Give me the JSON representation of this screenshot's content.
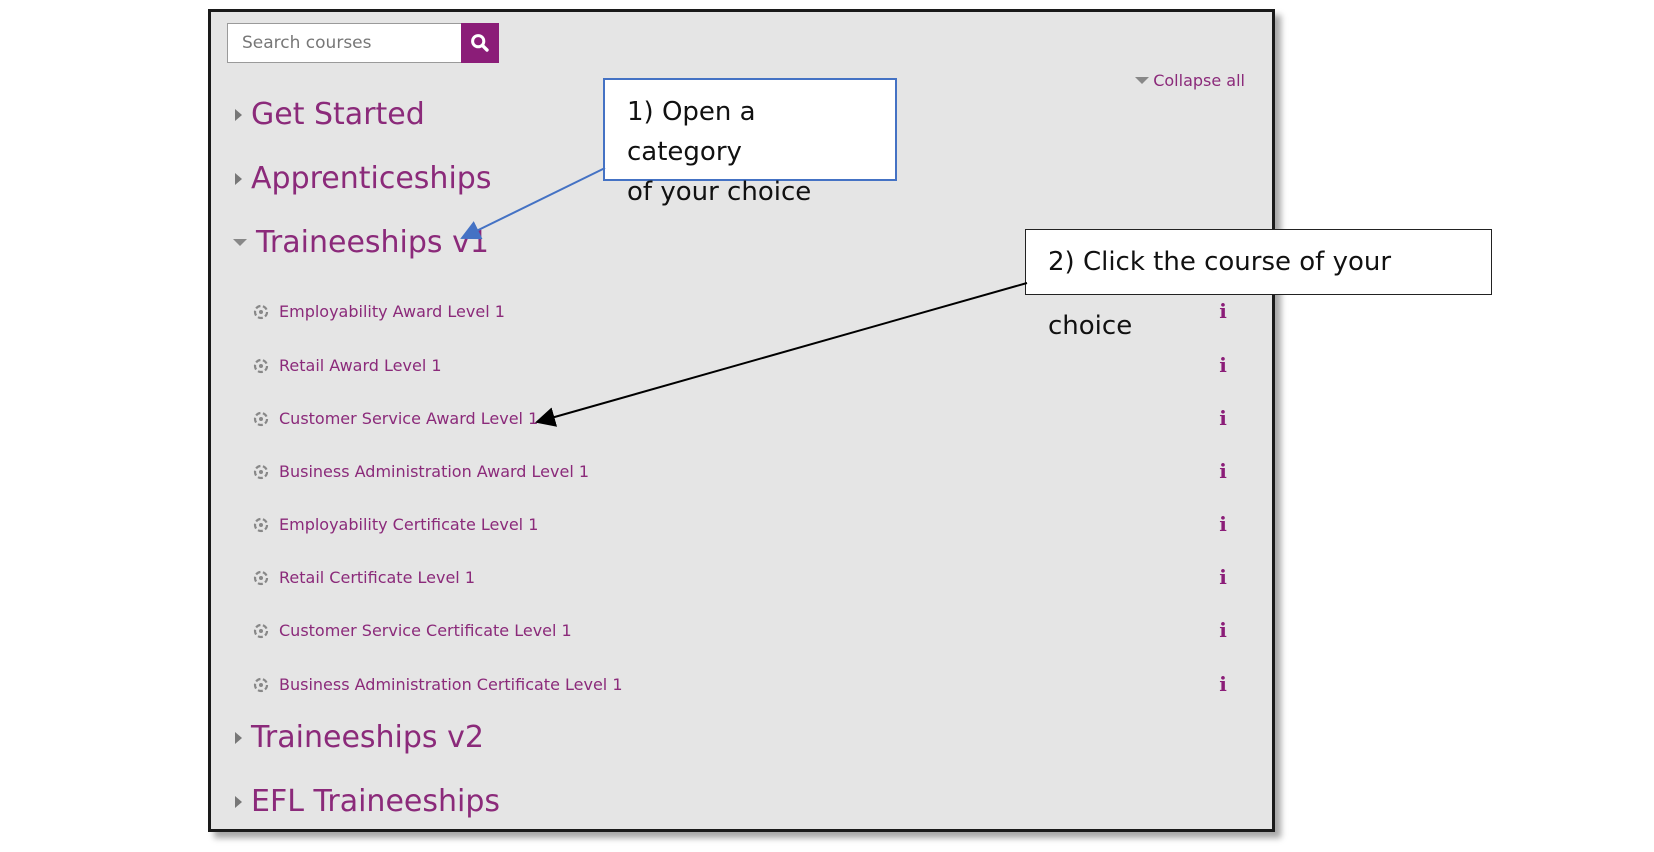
{
  "search": {
    "placeholder": "Search courses"
  },
  "collapse_all_label": "Collapse all",
  "categories": {
    "get_started": "Get Started",
    "apprenticeships": "Apprenticeships",
    "traineeships_v1": "Traineeships v1",
    "traineeships_v2": "Traineeships v2",
    "efl_traineeships": "EFL Traineeships"
  },
  "courses": [
    "Employability Award Level 1",
    "Retail Award Level 1",
    "Customer Service Award Level 1",
    "Business Administration Award Level 1",
    "Employability Certificate Level 1",
    "Retail Certificate Level 1",
    "Customer Service Certificate Level 1",
    "Business Administration Certificate Level 1"
  ],
  "info_label": "i",
  "callouts": {
    "step1_line1": "1) Open a category",
    "step1_line2": "of your choice",
    "step2": "2) Click the course of your choice"
  },
  "colors": {
    "accent": "#8b1d78",
    "link": "#8b2a7a",
    "panel_bg": "#e5e5e5",
    "callout1_border": "#4472c4"
  },
  "icons": {
    "search": "magnifier-icon",
    "course": "course-icon",
    "info": "info-icon"
  }
}
